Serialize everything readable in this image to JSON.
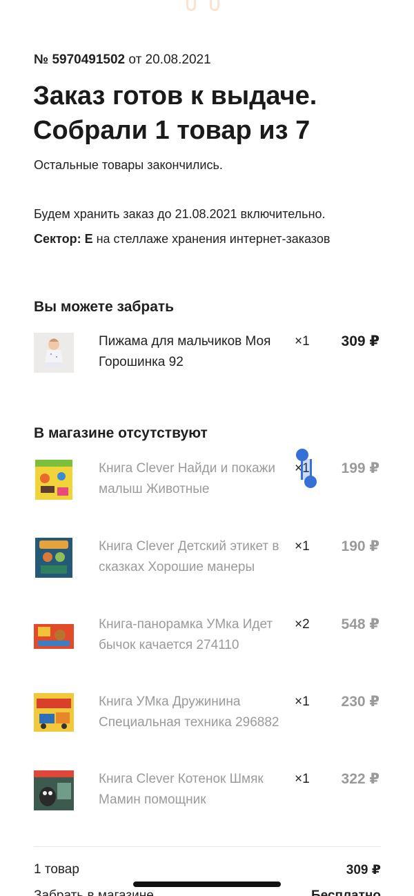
{
  "order": {
    "number_label": "№ 5970491502",
    "date_text": "от 20.08.2021",
    "title_line1": "Заказ готов к выдаче.",
    "title_line2": "Собрали 1 товар из 7",
    "note": "Остальные товары закончились.",
    "storage_text": "Будем хранить заказ до 21.08.2021 включительно.",
    "sector_label": "Сектор: Е",
    "sector_text": "на стеллаже хранения интернет-заказов"
  },
  "available": {
    "heading": "Вы можете забрать",
    "items": [
      {
        "name": "Пижама для мальчиков Моя Горошинка 92",
        "qty": "×1",
        "price": "309 ₽",
        "thumb": "baby-photo"
      }
    ]
  },
  "absent": {
    "heading": "В магазине отсутствуют",
    "items": [
      {
        "name": "Книга Clever Найди и покажи малыш Животные",
        "qty": "×1",
        "price": "199 ₽",
        "thumb": "book-animals"
      },
      {
        "name": "Книга Clever Детский этикет в сказках Хорошие манеры",
        "qty": "×1",
        "price": "190 ₽",
        "thumb": "book-manners"
      },
      {
        "name": "Книга-панорамка УМка Идет бычок качается 274110",
        "qty": "×2",
        "price": "548 ₽",
        "thumb": "book-panorama"
      },
      {
        "name": "Книга УМка Дружинина Специальная техника 296882",
        "qty": "×1",
        "price": "230 ₽",
        "thumb": "book-machinery"
      },
      {
        "name": "Книга Clever Котенок Шмяк Мамин помощник",
        "qty": "×1",
        "price": "322 ₽",
        "thumb": "book-cat"
      }
    ]
  },
  "summary": {
    "count_label": "1 товар",
    "count_value": "309 ₽",
    "pickup_label": "Забрать в магазине",
    "pickup_value": "Бесплатно"
  },
  "colors": {
    "text": "#1f1f1f",
    "muted": "#9a9a9a",
    "selection": "#3470d6"
  }
}
